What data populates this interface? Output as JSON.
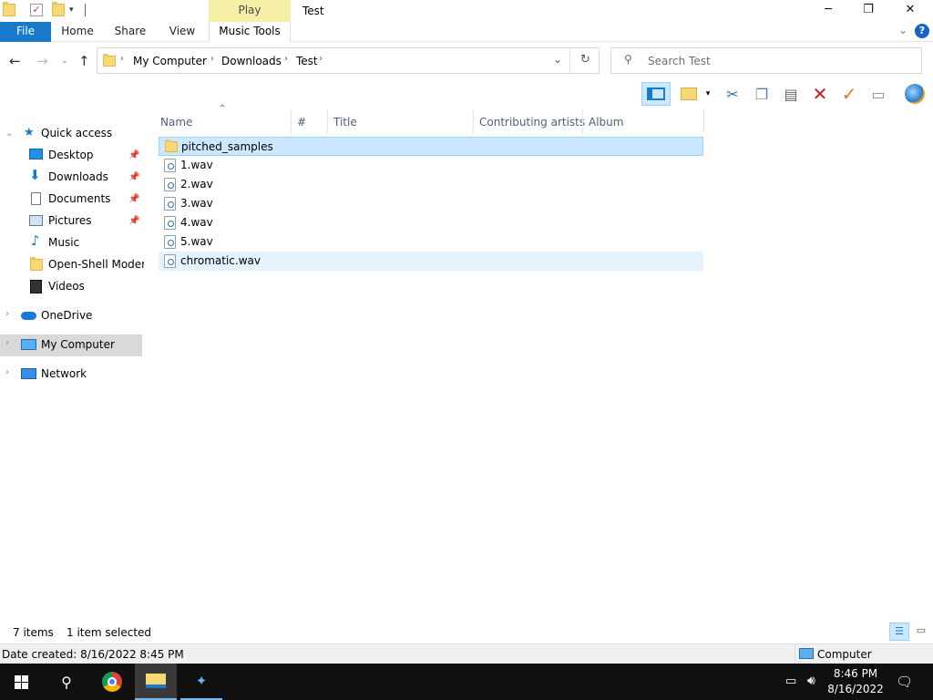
{
  "window": {
    "title": "Test",
    "context_tab_label": "Play",
    "controls": {
      "minimize": "─",
      "maximize": "❐",
      "close": "✕"
    }
  },
  "ribbon": {
    "file_label": "File",
    "tabs": [
      "Home",
      "Share",
      "View"
    ],
    "music_tools_label": "Music Tools"
  },
  "nav": {
    "breadcrumb": [
      "My Computer",
      "Downloads",
      "Test"
    ],
    "search_placeholder": "Search Test"
  },
  "sidebar": {
    "quick_access": "Quick access",
    "items": [
      {
        "label": "Desktop",
        "icon": "desktop-icon",
        "pinned": true
      },
      {
        "label": "Downloads",
        "icon": "downloads-icon",
        "pinned": true
      },
      {
        "label": "Documents",
        "icon": "documents-icon",
        "pinned": true
      },
      {
        "label": "Pictures",
        "icon": "pictures-icon",
        "pinned": true
      },
      {
        "label": "Music",
        "icon": "music-icon",
        "pinned": false
      },
      {
        "label": "Open-Shell Modern",
        "icon": "folder-icon",
        "pinned": false
      },
      {
        "label": "Videos",
        "icon": "videos-icon",
        "pinned": false
      }
    ],
    "onedrive": "OneDrive",
    "my_computer": "My Computer",
    "network": "Network"
  },
  "columns": [
    "Name",
    "#",
    "Title",
    "Contributing artists",
    "Album"
  ],
  "files": [
    {
      "name": "pitched_samples",
      "type": "folder",
      "state": "selected"
    },
    {
      "name": "1.wav",
      "type": "wav",
      "state": "normal"
    },
    {
      "name": "2.wav",
      "type": "wav",
      "state": "normal"
    },
    {
      "name": "3.wav",
      "type": "wav",
      "state": "normal"
    },
    {
      "name": "4.wav",
      "type": "wav",
      "state": "normal"
    },
    {
      "name": "5.wav",
      "type": "wav",
      "state": "normal"
    },
    {
      "name": "chromatic.wav",
      "type": "wav",
      "state": "hover"
    }
  ],
  "status": {
    "item_count": "7 items",
    "selection": "1 item selected"
  },
  "details": {
    "date_created": "Date created: 8/16/2022 8:45 PM",
    "location": "Computer"
  },
  "taskbar": {
    "time": "8:46 PM",
    "date": "8/16/2022"
  },
  "colors": {
    "accent": "#1979ca",
    "selected_row": "#cce8ff",
    "hover_row": "#e5f3ff",
    "taskbar": "#101010"
  }
}
